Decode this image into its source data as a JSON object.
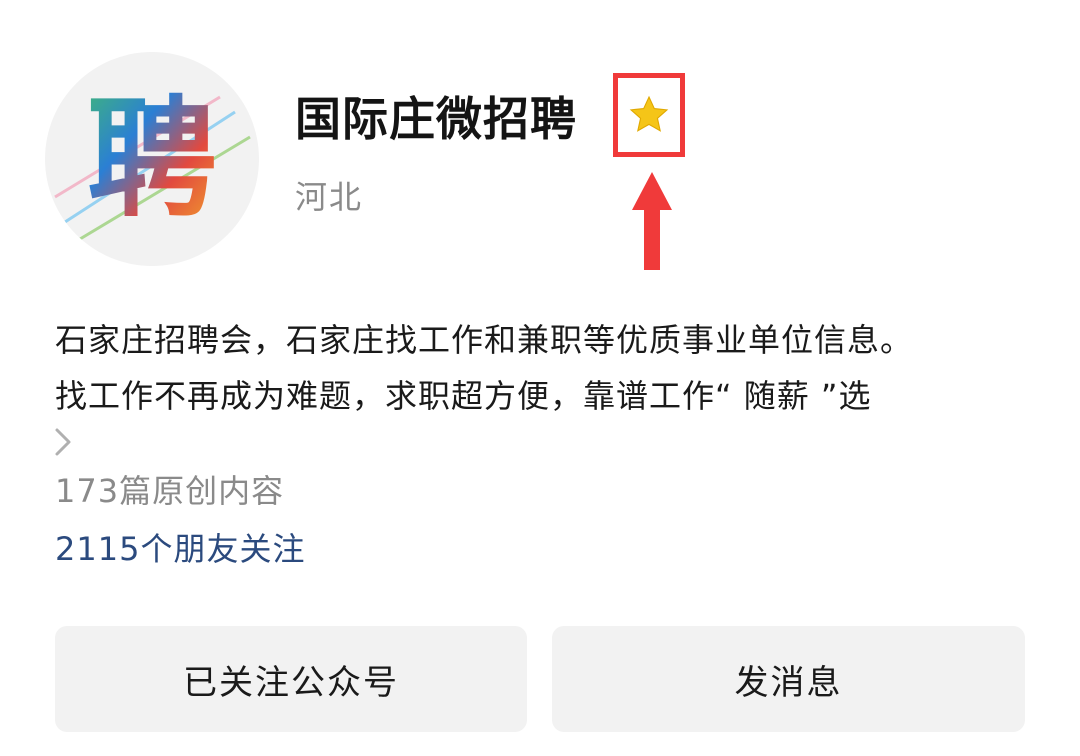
{
  "account": {
    "name": "国际庄微招聘",
    "avatar_text": "聘",
    "region": "河北",
    "description_lines": [
      "石家庄招聘会，石家庄找工作和兼职等优质事业单位信息。",
      "找工作不再成为难题，求职超方便，靠谱工作“ 随薪 ”选"
    ],
    "articles": "173篇原创内容",
    "followers": "2115个朋友关注"
  },
  "actions": {
    "follow_label": "已关注公众号",
    "message_label": "发消息"
  },
  "icons": {
    "star": "star-icon",
    "expand": "chevron-right-icon",
    "annotation_arrow": "up-arrow-icon"
  },
  "colors": {
    "star": "#f5c518",
    "highlight": "#f03a3a",
    "followers_link": "#2b4a7e",
    "button_bg": "#f2f2f2",
    "muted_text": "#8a8a8a"
  }
}
